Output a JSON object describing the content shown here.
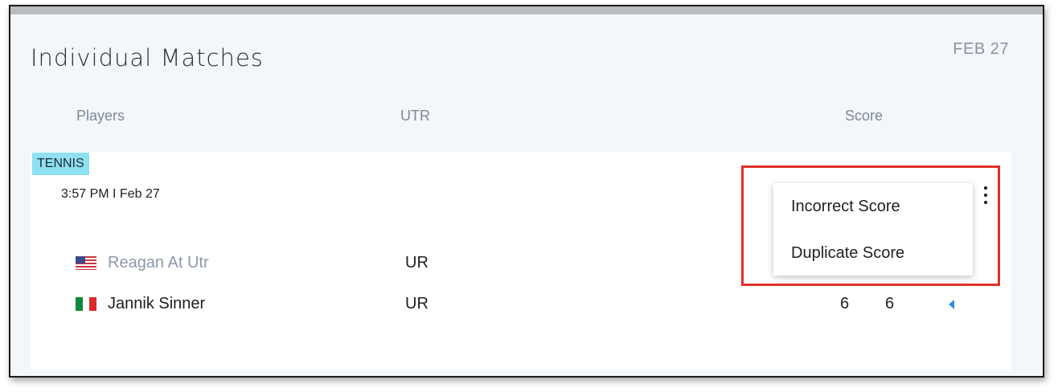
{
  "section": {
    "title": "Individual Matches",
    "date": "FEB 27"
  },
  "columns": {
    "players": "Players",
    "utr": "UTR",
    "score": "Score"
  },
  "match": {
    "sport": "TENNIS",
    "time": "3:57 PM I Feb 27",
    "players": [
      {
        "name": "Reagan At Utr",
        "flag": "us-flag-icon",
        "utr": "UR",
        "scores": [],
        "winner": false
      },
      {
        "name": "Jannik Sinner",
        "flag": "italy-flag-icon",
        "utr": "UR",
        "scores": [
          "6",
          "6"
        ],
        "winner": true
      }
    ]
  },
  "context_menu": {
    "items": [
      "Incorrect Score",
      "Duplicate Score"
    ],
    "trigger_icon": "more-vertical-icon"
  },
  "colors": {
    "tag_bg": "#8fe0f3",
    "link_name": "#8c98aa",
    "winner_caret": "#2b8fe8",
    "highlight_border": "#e0302a",
    "flag_it_green": "#0f8a3d",
    "flag_it_red": "#d92b2b"
  }
}
